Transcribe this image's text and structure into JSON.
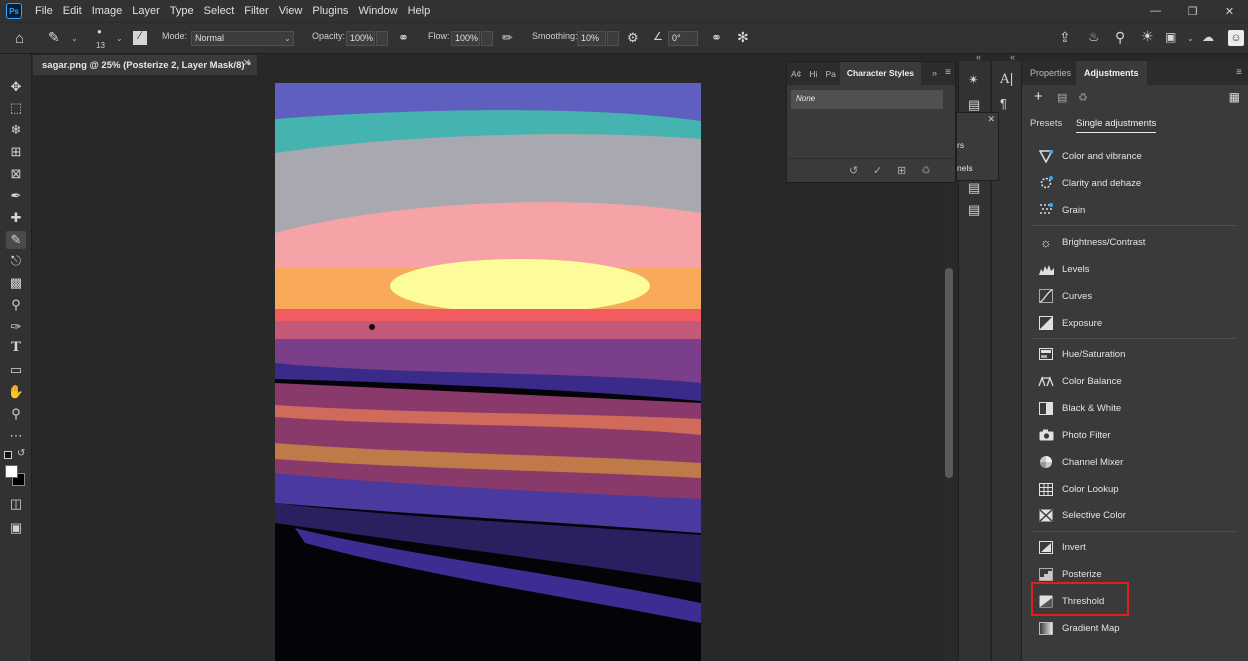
{
  "menubar": {
    "logo": "Ps",
    "items": [
      "File",
      "Edit",
      "Image",
      "Layer",
      "Type",
      "Select",
      "Filter",
      "View",
      "Plugins",
      "Window",
      "Help"
    ]
  },
  "options": {
    "brush_size": "13",
    "mode_label": "Mode:",
    "mode_value": "Normal",
    "opacity_label": "Opacity:",
    "opacity_value": "100%",
    "flow_label": "Flow:",
    "flow_value": "100%",
    "smoothing_label": "Smoothing:",
    "smoothing_value": "10%",
    "angle_value": "0°"
  },
  "document": {
    "tab_title": "sagar.png @ 25% (Posterize 2, Layer Mask/8) *"
  },
  "char_panel": {
    "tabs": [
      "A¢",
      "Hi",
      "Pa"
    ],
    "active_tab": "Character Styles",
    "list_item": "None"
  },
  "fragment_panel": {
    "line1": "rs",
    "line2": "nels"
  },
  "right_panel": {
    "tabs": [
      "Properties",
      "Adjustments"
    ],
    "subtabs": [
      "Presets",
      "Single adjustments"
    ],
    "groups": [
      [
        "Color and vibrance",
        "Clarity and dehaze",
        "Grain"
      ],
      [
        "Brightness/Contrast",
        "Levels",
        "Curves",
        "Exposure"
      ],
      [
        "Hue/Saturation",
        "Color Balance",
        "Black & White",
        "Photo Filter",
        "Channel Mixer",
        "Color Lookup",
        "Selective Color"
      ],
      [
        "Invert",
        "Posterize",
        "Threshold",
        "Gradient Map"
      ]
    ],
    "highlighted": "Threshold"
  },
  "colors": {
    "highlight": "#e21d1d",
    "accent": "#31a8ff"
  }
}
